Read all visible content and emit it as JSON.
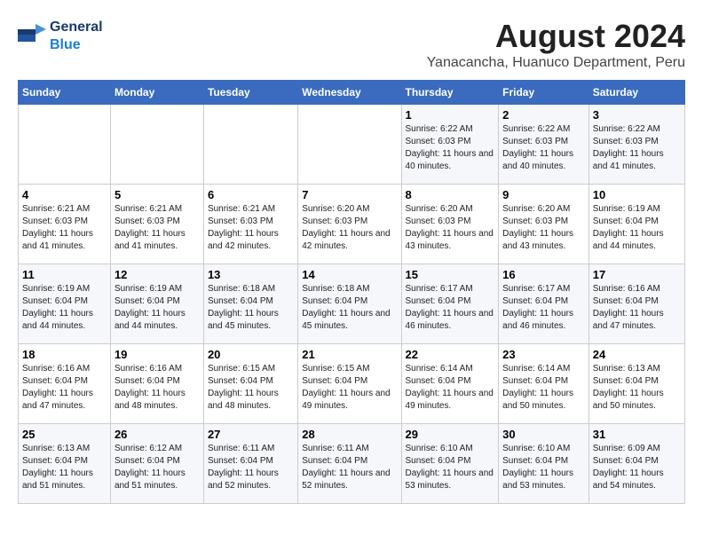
{
  "header": {
    "logo_general": "General",
    "logo_blue": "Blue",
    "main_title": "August 2024",
    "subtitle": "Yanacancha, Huanuco Department, Peru"
  },
  "calendar": {
    "days_of_week": [
      "Sunday",
      "Monday",
      "Tuesday",
      "Wednesday",
      "Thursday",
      "Friday",
      "Saturday"
    ],
    "weeks": [
      [
        {
          "day": "",
          "info": ""
        },
        {
          "day": "",
          "info": ""
        },
        {
          "day": "",
          "info": ""
        },
        {
          "day": "",
          "info": ""
        },
        {
          "day": "1",
          "info": "Sunrise: 6:22 AM\nSunset: 6:03 PM\nDaylight: 11 hours and 40 minutes."
        },
        {
          "day": "2",
          "info": "Sunrise: 6:22 AM\nSunset: 6:03 PM\nDaylight: 11 hours and 40 minutes."
        },
        {
          "day": "3",
          "info": "Sunrise: 6:22 AM\nSunset: 6:03 PM\nDaylight: 11 hours and 41 minutes."
        }
      ],
      [
        {
          "day": "4",
          "info": "Sunrise: 6:21 AM\nSunset: 6:03 PM\nDaylight: 11 hours and 41 minutes."
        },
        {
          "day": "5",
          "info": "Sunrise: 6:21 AM\nSunset: 6:03 PM\nDaylight: 11 hours and 41 minutes."
        },
        {
          "day": "6",
          "info": "Sunrise: 6:21 AM\nSunset: 6:03 PM\nDaylight: 11 hours and 42 minutes."
        },
        {
          "day": "7",
          "info": "Sunrise: 6:20 AM\nSunset: 6:03 PM\nDaylight: 11 hours and 42 minutes."
        },
        {
          "day": "8",
          "info": "Sunrise: 6:20 AM\nSunset: 6:03 PM\nDaylight: 11 hours and 43 minutes."
        },
        {
          "day": "9",
          "info": "Sunrise: 6:20 AM\nSunset: 6:03 PM\nDaylight: 11 hours and 43 minutes."
        },
        {
          "day": "10",
          "info": "Sunrise: 6:19 AM\nSunset: 6:04 PM\nDaylight: 11 hours and 44 minutes."
        }
      ],
      [
        {
          "day": "11",
          "info": "Sunrise: 6:19 AM\nSunset: 6:04 PM\nDaylight: 11 hours and 44 minutes."
        },
        {
          "day": "12",
          "info": "Sunrise: 6:19 AM\nSunset: 6:04 PM\nDaylight: 11 hours and 44 minutes."
        },
        {
          "day": "13",
          "info": "Sunrise: 6:18 AM\nSunset: 6:04 PM\nDaylight: 11 hours and 45 minutes."
        },
        {
          "day": "14",
          "info": "Sunrise: 6:18 AM\nSunset: 6:04 PM\nDaylight: 11 hours and 45 minutes."
        },
        {
          "day": "15",
          "info": "Sunrise: 6:17 AM\nSunset: 6:04 PM\nDaylight: 11 hours and 46 minutes."
        },
        {
          "day": "16",
          "info": "Sunrise: 6:17 AM\nSunset: 6:04 PM\nDaylight: 11 hours and 46 minutes."
        },
        {
          "day": "17",
          "info": "Sunrise: 6:16 AM\nSunset: 6:04 PM\nDaylight: 11 hours and 47 minutes."
        }
      ],
      [
        {
          "day": "18",
          "info": "Sunrise: 6:16 AM\nSunset: 6:04 PM\nDaylight: 11 hours and 47 minutes."
        },
        {
          "day": "19",
          "info": "Sunrise: 6:16 AM\nSunset: 6:04 PM\nDaylight: 11 hours and 48 minutes."
        },
        {
          "day": "20",
          "info": "Sunrise: 6:15 AM\nSunset: 6:04 PM\nDaylight: 11 hours and 48 minutes."
        },
        {
          "day": "21",
          "info": "Sunrise: 6:15 AM\nSunset: 6:04 PM\nDaylight: 11 hours and 49 minutes."
        },
        {
          "day": "22",
          "info": "Sunrise: 6:14 AM\nSunset: 6:04 PM\nDaylight: 11 hours and 49 minutes."
        },
        {
          "day": "23",
          "info": "Sunrise: 6:14 AM\nSunset: 6:04 PM\nDaylight: 11 hours and 50 minutes."
        },
        {
          "day": "24",
          "info": "Sunrise: 6:13 AM\nSunset: 6:04 PM\nDaylight: 11 hours and 50 minutes."
        }
      ],
      [
        {
          "day": "25",
          "info": "Sunrise: 6:13 AM\nSunset: 6:04 PM\nDaylight: 11 hours and 51 minutes."
        },
        {
          "day": "26",
          "info": "Sunrise: 6:12 AM\nSunset: 6:04 PM\nDaylight: 11 hours and 51 minutes."
        },
        {
          "day": "27",
          "info": "Sunrise: 6:11 AM\nSunset: 6:04 PM\nDaylight: 11 hours and 52 minutes."
        },
        {
          "day": "28",
          "info": "Sunrise: 6:11 AM\nSunset: 6:04 PM\nDaylight: 11 hours and 52 minutes."
        },
        {
          "day": "29",
          "info": "Sunrise: 6:10 AM\nSunset: 6:04 PM\nDaylight: 11 hours and 53 minutes."
        },
        {
          "day": "30",
          "info": "Sunrise: 6:10 AM\nSunset: 6:04 PM\nDaylight: 11 hours and 53 minutes."
        },
        {
          "day": "31",
          "info": "Sunrise: 6:09 AM\nSunset: 6:04 PM\nDaylight: 11 hours and 54 minutes."
        }
      ]
    ]
  }
}
